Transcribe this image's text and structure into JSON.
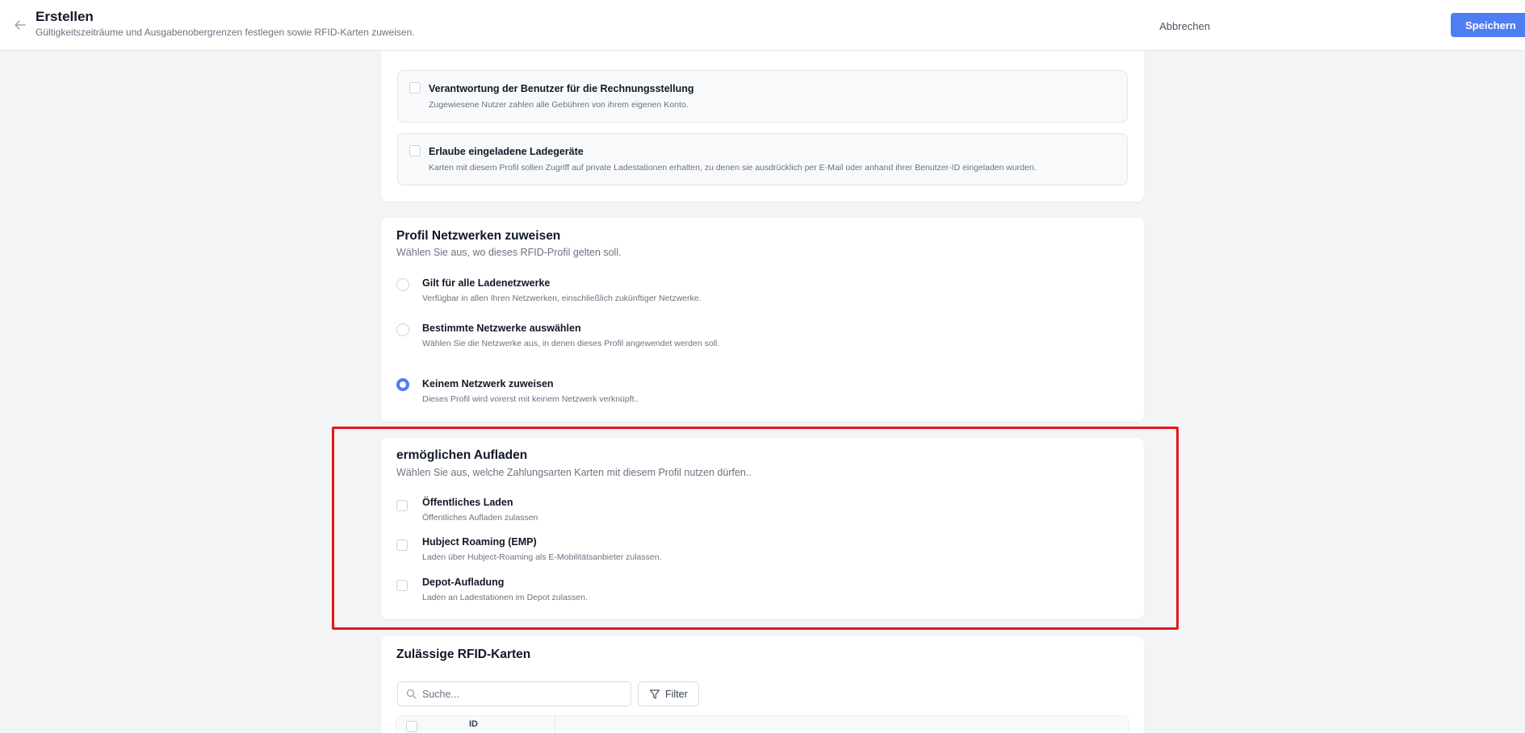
{
  "header": {
    "title": "Erstellen",
    "subtitle": "Gültigkeitszeiträume und Ausgabenobergrenzen festlegen sowie RFID-Karten zuweisen.",
    "cancel_label": "Abbrechen",
    "save_label": "Speichern",
    "accent_color": "#4f7df3"
  },
  "options_card": {
    "items": [
      {
        "label": "Verantwortung der Benutzer für die Rechnungsstellung",
        "description": "Zugewiesene Nutzer zahlen alle Gebühren von ihrem eigenen Konto.",
        "checked": false
      },
      {
        "label": "Erlaube eingeladene Ladegeräte",
        "description": "Karten mit diesem Profil sollen Zugriff auf private Ladestationen erhalten, zu denen sie ausdrücklich per E-Mail oder anhand ihrer Benutzer-ID eingeladen wurden.",
        "checked": false
      }
    ]
  },
  "networks_card": {
    "title": "Profil Netzwerken zuweisen",
    "description": "Wählen Sie aus, wo dieses RFID-Profil gelten soll.",
    "options": [
      {
        "label": "Gilt für alle Ladenetzwerke",
        "description": "Verfügbar in allen Ihren Netzwerken, einschließlich zukünftiger Netzwerke.",
        "selected": false
      },
      {
        "label": "Bestimmte Netzwerke auswählen",
        "description": "Wählen Sie die Netzwerke aus, in denen dieses Profil angewendet werden soll.",
        "selected": false
      },
      {
        "label": "Keinem Netzwerk zuweisen",
        "description": "Dieses Profil wird vorerst mit keinem Netzwerk verknüpft..",
        "selected": true
      }
    ]
  },
  "charging_card": {
    "title": "ermöglichen Aufladen",
    "description": "Wählen Sie aus, welche Zahlungsarten Karten mit diesem Profil nutzen dürfen..",
    "highlight_color": "#e8161b",
    "options": [
      {
        "label": "Öffentliches Laden",
        "description": "Öffentliches Aufladen zulassen",
        "checked": false
      },
      {
        "label": "Hubject Roaming (EMP)",
        "description": "Laden über Hubject-Roaming als E-Mobilitätsanbieter zulassen.",
        "checked": false
      },
      {
        "label": "Depot-Aufladung",
        "description": "Laden an Ladestationen im Depot zulassen.",
        "checked": false
      }
    ]
  },
  "rfid_card": {
    "title": "Zulässige RFID-Karten",
    "search_placeholder": "Suche...",
    "filter_label": "Filter",
    "column_id": "ID"
  }
}
